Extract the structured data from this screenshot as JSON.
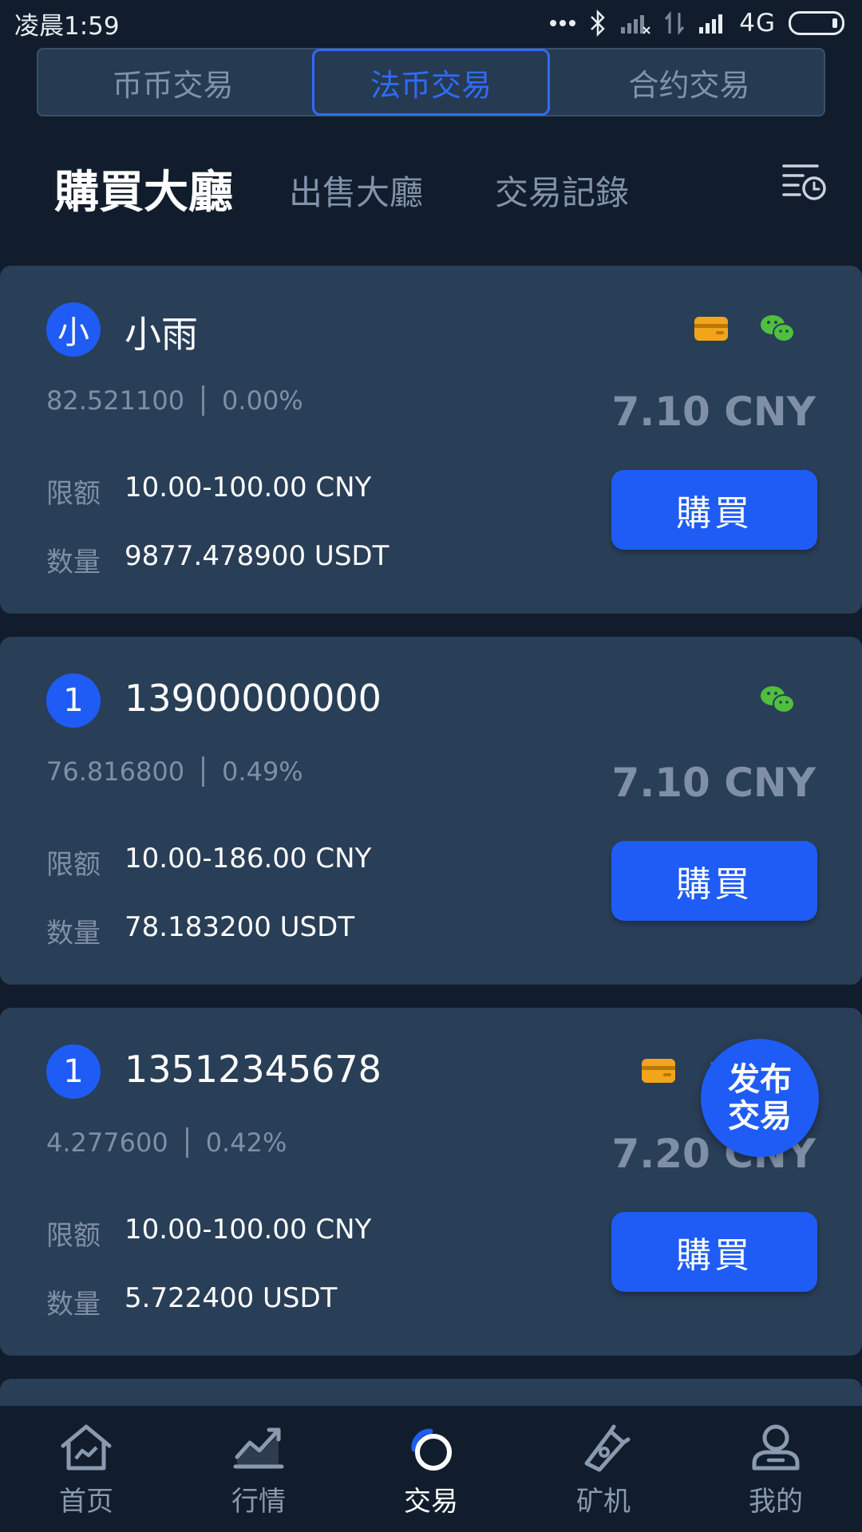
{
  "status_bar": {
    "time": "凌晨1:59",
    "network": "4G"
  },
  "segment_tabs": [
    {
      "label": "币币交易"
    },
    {
      "label": "法币交易"
    },
    {
      "label": "合约交易"
    }
  ],
  "sub_tabs": {
    "buy": "購買大廳",
    "sell": "出售大廳",
    "records": "交易記錄"
  },
  "labels": {
    "limit": "限额",
    "quantity": "数量"
  },
  "listings": [
    {
      "avatar": "小",
      "name": "小雨",
      "balance": "82.521100",
      "rate": "0.00%",
      "price": "7.10 CNY",
      "limit": "10.00-100.00 CNY",
      "quantity": "9877.478900 USDT",
      "button": "購買",
      "payment": [
        "bank-card",
        "wechat"
      ]
    },
    {
      "avatar": "1",
      "name": "13900000000",
      "balance": "76.816800",
      "rate": "0.49%",
      "price": "7.10 CNY",
      "limit": "10.00-186.00 CNY",
      "quantity": "78.183200 USDT",
      "button": "購買",
      "payment": [
        "wechat"
      ]
    },
    {
      "avatar": "1",
      "name": "13512345678",
      "balance": "4.277600",
      "rate": "0.42%",
      "price": "7.20 CNY",
      "limit": "10.00-100.00 CNY",
      "quantity": "5.722400 USDT",
      "button": "購買",
      "payment": [
        "bank-card",
        "alipay"
      ]
    }
  ],
  "fab": {
    "line1": "发布",
    "line2": "交易"
  },
  "bottom_nav": [
    {
      "label": "首页",
      "icon": "home-icon"
    },
    {
      "label": "行情",
      "icon": "market-chart-icon"
    },
    {
      "label": "交易",
      "icon": "trade-icon",
      "active": true
    },
    {
      "label": "矿机",
      "icon": "miner-icon"
    },
    {
      "label": "我的",
      "icon": "profile-icon"
    }
  ],
  "colors": {
    "background": "#111d2c",
    "card": "#293e57",
    "accent": "#1f5cf5",
    "muted": "#7f90a6",
    "bank_card": "#f2a51a",
    "wechat": "#4fc03e",
    "alipay": "#1f8de0"
  }
}
